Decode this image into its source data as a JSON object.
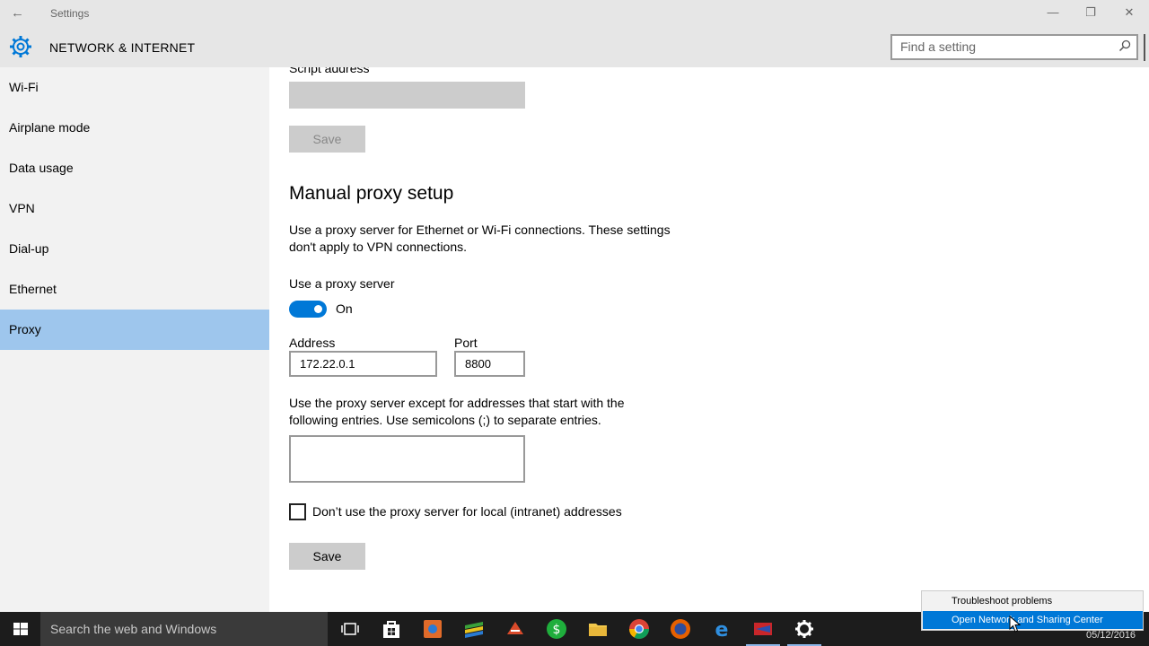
{
  "window": {
    "back_glyph": "←",
    "app_title": "Settings",
    "minimize_glyph": "—",
    "maximize_glyph": "❐",
    "close_glyph": "✕"
  },
  "header": {
    "section_title": "NETWORK & INTERNET",
    "search_placeholder": "Find a setting"
  },
  "sidebar": {
    "items": [
      {
        "label": "Wi-Fi"
      },
      {
        "label": "Airplane mode"
      },
      {
        "label": "Data usage"
      },
      {
        "label": "VPN"
      },
      {
        "label": "Dial-up"
      },
      {
        "label": "Ethernet"
      },
      {
        "label": "Proxy",
        "selected": true
      }
    ]
  },
  "automatic": {
    "script_address_label": "Script address",
    "script_address_value": "",
    "save_label": "Save"
  },
  "manual": {
    "heading": "Manual proxy setup",
    "description": "Use a proxy server for Ethernet or Wi-Fi connections. These settings don't apply to VPN connections.",
    "use_proxy_label": "Use a proxy server",
    "toggle_state": "On",
    "address_label": "Address",
    "address_value": "172.22.0.1",
    "port_label": "Port",
    "port_value": "8800",
    "exceptions_text": "Use the proxy server except for addresses that start with the following entries. Use semicolons (;) to separate entries.",
    "exceptions_value": "",
    "local_bypass_label": "Don’t use the proxy server for local (intranet) addresses",
    "local_bypass_checked": false,
    "save_label": "Save"
  },
  "taskbar": {
    "search_text": "Search the web and Windows",
    "date": "05/12/2016",
    "icons": [
      "windows-start-icon",
      "task-view-icon",
      "store-icon",
      "app-icon",
      "app-icon",
      "app-icon",
      "app-icon",
      "file-explorer-icon",
      "chrome-icon",
      "firefox-icon",
      "edge-icon",
      "app-icon",
      "settings-icon"
    ]
  },
  "context_menu": {
    "items": [
      {
        "label": "Troubleshoot problems"
      },
      {
        "label": "Open Network and Sharing Center",
        "highlighted": true
      }
    ]
  },
  "colors": {
    "accent": "#0078d7",
    "selected_nav": "#9ec6ed",
    "chrome_bg": "#e6e6e6",
    "sidebar_bg": "#f2f2f2",
    "taskbar_bg": "#1c1c1c"
  }
}
